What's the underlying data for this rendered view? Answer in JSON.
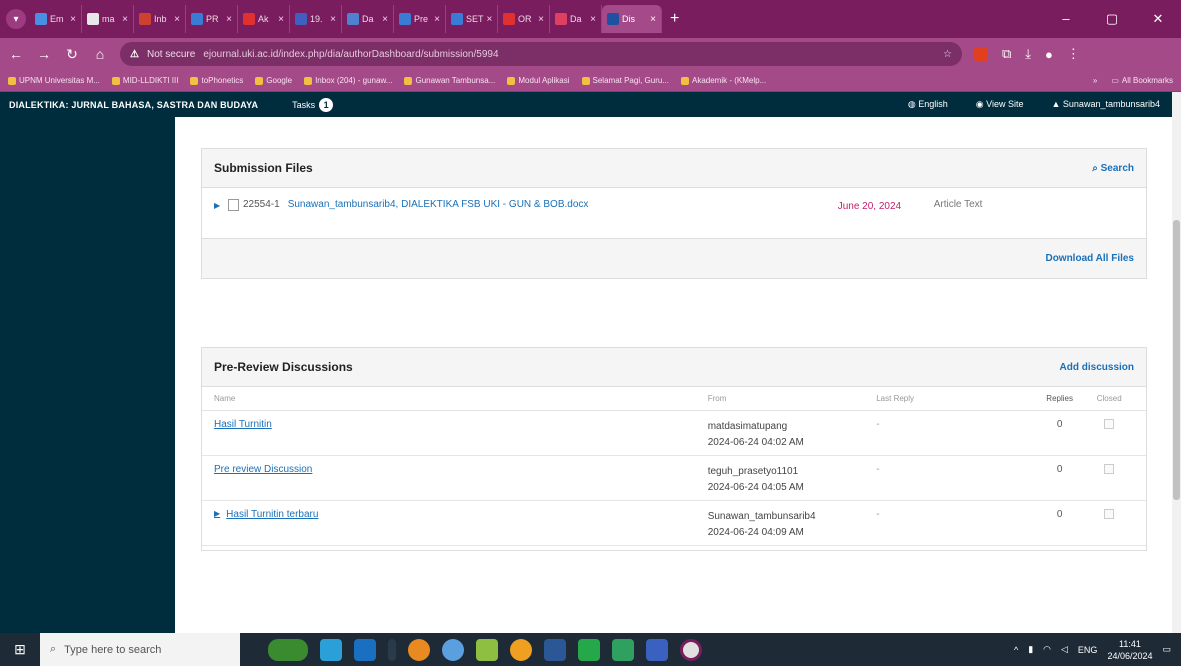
{
  "browser": {
    "tabs": [
      {
        "label": "Em",
        "color": "#4a90e2"
      },
      {
        "label": "ma",
        "color": "#e8e8e8"
      },
      {
        "label": "Inb",
        "color": "#d04030"
      },
      {
        "label": "PR",
        "color": "#3a7bd5"
      },
      {
        "label": "Ak",
        "color": "#e03030"
      },
      {
        "label": "19.",
        "color": "#4060c0"
      },
      {
        "label": "Da",
        "color": "#5080d0"
      },
      {
        "label": "Pre",
        "color": "#3a7bd5"
      },
      {
        "label": "SET",
        "color": "#3a7bd5"
      },
      {
        "label": "OR",
        "color": "#e03030"
      },
      {
        "label": "Da",
        "color": "#e04060"
      },
      {
        "label": "Dis",
        "color": "#2050a0",
        "active": true
      }
    ],
    "security": "Not secure",
    "url": "ejournal.uki.ac.id/index.php/dia/authorDashboard/submission/5994",
    "bookmarks": [
      "UPNM Universitas M...",
      "MID-LLDIKTI III",
      "toPhonetics",
      "Google",
      "Inbox (204) - gunaw...",
      "Gunawan Tambunsa...",
      "Modul Aplikasi",
      "Selamat Pagi, Guru...",
      "Akademik - (KMelp..."
    ],
    "all_bookmarks": "All Bookmarks"
  },
  "ojs": {
    "journal_name": "DIALEKTIKA: JURNAL BAHASA, SASTRA DAN BUDAYA",
    "tasks_label": "Tasks",
    "tasks_count": "1",
    "language": "English",
    "view_site": "View Site",
    "user": "Sunawan_tambunsarib4"
  },
  "submission_files": {
    "title": "Submission Files",
    "search_label": "Search",
    "files": [
      {
        "id": "22554-1",
        "name": "Sunawan_tambunsarib4, DIALEKTIKA FSB UKI - GUN & BOB.docx",
        "date": "June 20, 2024",
        "type": "Article Text"
      }
    ],
    "download_all": "Download All Files"
  },
  "discussions": {
    "title": "Pre-Review Discussions",
    "add_label": "Add discussion",
    "columns": {
      "name": "Name",
      "from": "From",
      "last_reply": "Last Reply",
      "replies": "Replies",
      "closed": "Closed"
    },
    "rows": [
      {
        "name": "Hasil Turnitin",
        "from_user": "matdasimatupang",
        "from_time": "2024-06-24 04:02 AM",
        "last_reply": "-",
        "replies": "0",
        "expandable": false
      },
      {
        "name": "Pre review Discussion",
        "from_user": "teguh_prasetyo1101",
        "from_time": "2024-06-24 04:05 AM",
        "last_reply": "-",
        "replies": "0",
        "expandable": false
      },
      {
        "name": "Hasil Turnitin terbaru",
        "from_user": "Sunawan_tambunsarib4",
        "from_time": "2024-06-24 04:09 AM",
        "last_reply": "-",
        "replies": "0",
        "expandable": true
      }
    ]
  },
  "taskbar": {
    "search_placeholder": "Type here to search",
    "language": "ENG",
    "time": "11:41",
    "date": "24/06/2024"
  }
}
